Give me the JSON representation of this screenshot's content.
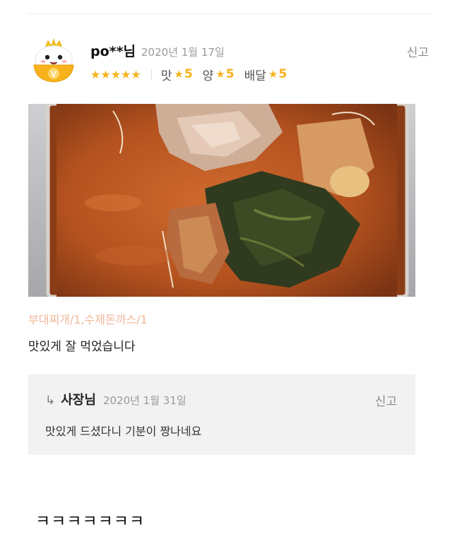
{
  "review": {
    "nickname": "po**님",
    "date": "2020년 1월 17일",
    "report_label": "신고",
    "overall_stars": "★★★★★",
    "overall_rating": 5,
    "ratings": [
      {
        "label": "맛",
        "star": "★",
        "value": "5"
      },
      {
        "label": "양",
        "star": "★",
        "value": "5"
      },
      {
        "label": "배달",
        "star": "★",
        "value": "5"
      }
    ],
    "menu_tags": "부대찌개/1,수제돈까스/1",
    "text": "맛있게 잘 먹었습니다"
  },
  "reply": {
    "arrow": "↳",
    "owner": "사장님",
    "date": "2020년 1월 31일",
    "report_label": "신고",
    "text": "맛있게 드셨다니 기분이 짱나네요"
  },
  "caption": "ㅋㅋㅋㅋㅋㅋㅋ",
  "colors": {
    "star": "#f7b21c",
    "menu_tags": "#f0b79a",
    "reply_bg": "#f2f2f2"
  },
  "icons": {
    "avatar": "vip-rice-bowl-crown-avatar-icon",
    "photo": "stew-food-photo"
  }
}
